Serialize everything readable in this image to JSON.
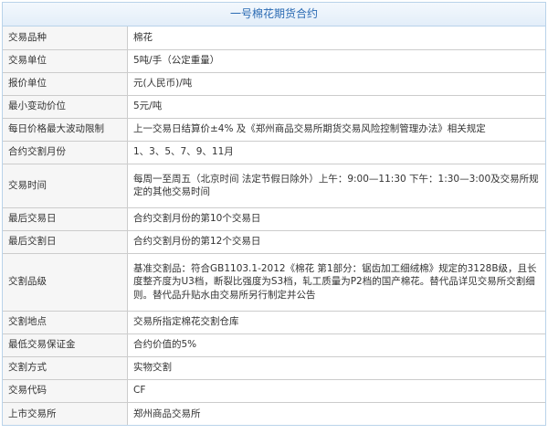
{
  "title": "一号棉花期货合约",
  "rows": [
    {
      "label": "交易品种",
      "value": "棉花"
    },
    {
      "label": "交易单位",
      "value": "5吨/手（公定重量）"
    },
    {
      "label": "报价单位",
      "value": "元(人民币)/吨"
    },
    {
      "label": "最小变动价位",
      "value": "5元/吨"
    },
    {
      "label": "每日价格最大波动限制",
      "value": "上一交易日结算价±4% 及《郑州商品交易所期货交易风险控制管理办法》相关规定"
    },
    {
      "label": "合约交割月份",
      "value": "1、3、5、7、9、11月"
    },
    {
      "label": "交易时间",
      "value": "每周一至周五（北京时间 法定节假日除外）上午：9:00—11:30 下午：1:30—3:00及交易所规定的其他交易时间"
    },
    {
      "label": "最后交易日",
      "value": "合约交割月份的第10个交易日"
    },
    {
      "label": "最后交割日",
      "value": "合约交割月份的第12个交易日"
    },
    {
      "label": "交割品级",
      "value": "基准交割品：符合GB1103.1-2012《棉花 第1部分：锯齿加工细绒棉》规定的3128B级，且长度整齐度为U3档，断裂比强度为S3档，轧工质量为P2档的国产棉花。替代品详见交易所交割细则。替代品升贴水由交易所另行制定并公告"
    },
    {
      "label": "交割地点",
      "value": "交易所指定棉花交割仓库"
    },
    {
      "label": "最低交易保证金",
      "value": "合约价值的5%"
    },
    {
      "label": "交割方式",
      "value": "实物交割"
    },
    {
      "label": "交易代码",
      "value": "CF"
    },
    {
      "label": "上市交易所",
      "value": "郑州商品交易所"
    }
  ]
}
